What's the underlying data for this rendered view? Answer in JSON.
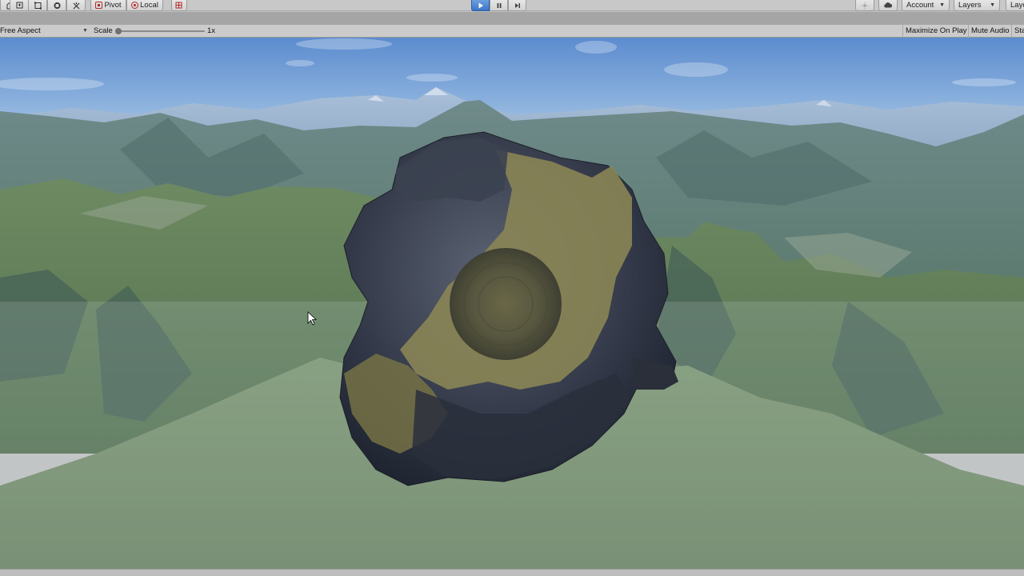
{
  "toolbar": {
    "tools": [
      "hand-tool-icon",
      "move-tool-icon",
      "rect-tool-icon",
      "transform-tool-icon",
      "custom-tool-icon"
    ],
    "pivot_label": "Pivot",
    "local_label": "Local",
    "account_label": "Account",
    "layers_label": "Layers",
    "layout_label": "Layo"
  },
  "game_view": {
    "aspect_label": "Free Aspect",
    "scale_label": "Scale",
    "scale_value": "1x",
    "maximize_label": "Maximize On Play",
    "mute_label": "Mute Audio",
    "stats_label": "Sta"
  },
  "colors": {
    "play_accent": "#3d75c6",
    "sky_top": "#5f8fd0",
    "asteroid_highlight": "#8a8555"
  }
}
